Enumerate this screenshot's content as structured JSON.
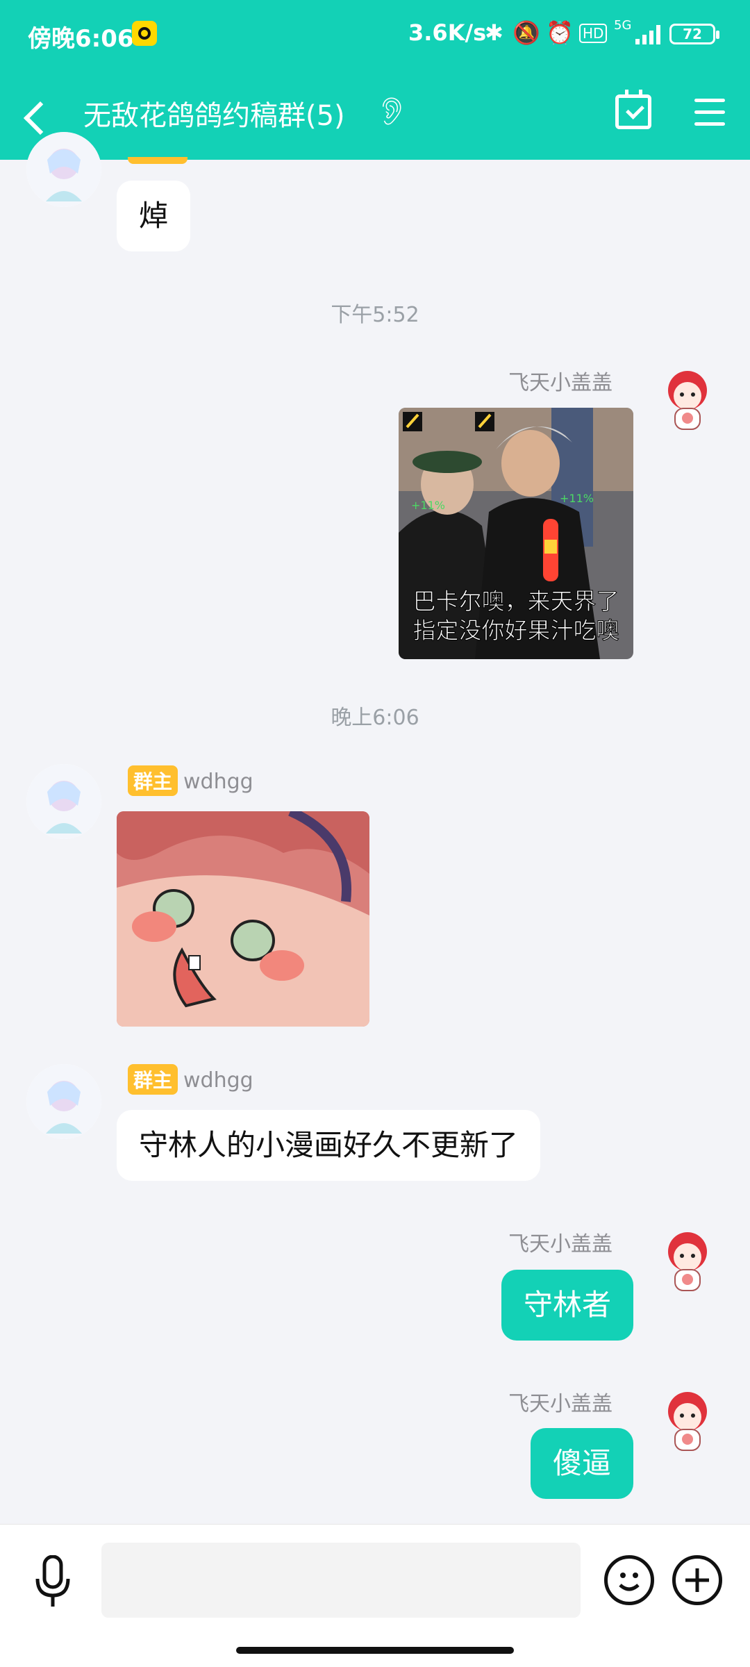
{
  "status": {
    "time": "傍晚6:06",
    "network_speed": "3.6K/s",
    "signal_type": "5G",
    "battery": "72"
  },
  "header": {
    "title": "无敌花鸽鸽约稿群(5)",
    "icons": [
      "back-icon",
      "ear-icon",
      "calendar-check-icon",
      "menu-icon"
    ]
  },
  "messages": [
    {
      "type": "text",
      "dir": "in",
      "text": "焯"
    },
    {
      "type": "time",
      "text": "下午5:52"
    },
    {
      "type": "image",
      "dir": "out",
      "sender": "飞天小盖盖",
      "caption_line1": "巴卡尔噢，来天界了",
      "caption_line2": "指定没你好果汁吃噢",
      "stat_left": "+11%",
      "stat_right": "+11%"
    },
    {
      "type": "time",
      "text": "晚上6:06"
    },
    {
      "type": "image",
      "dir": "in",
      "role": "群主",
      "sender": "wdhgg"
    },
    {
      "type": "text",
      "dir": "in",
      "role": "群主",
      "sender": "wdhgg",
      "text": "守林人的小漫画好久不更新了"
    },
    {
      "type": "text",
      "dir": "out",
      "sender": "飞天小盖盖",
      "text": "守林者"
    },
    {
      "type": "text",
      "dir": "out",
      "sender": "飞天小盖盖",
      "text": "傻逼"
    }
  ],
  "colors": {
    "accent": "#13d1b6",
    "badge": "#ffbf2e",
    "background": "#f3f4f8"
  }
}
